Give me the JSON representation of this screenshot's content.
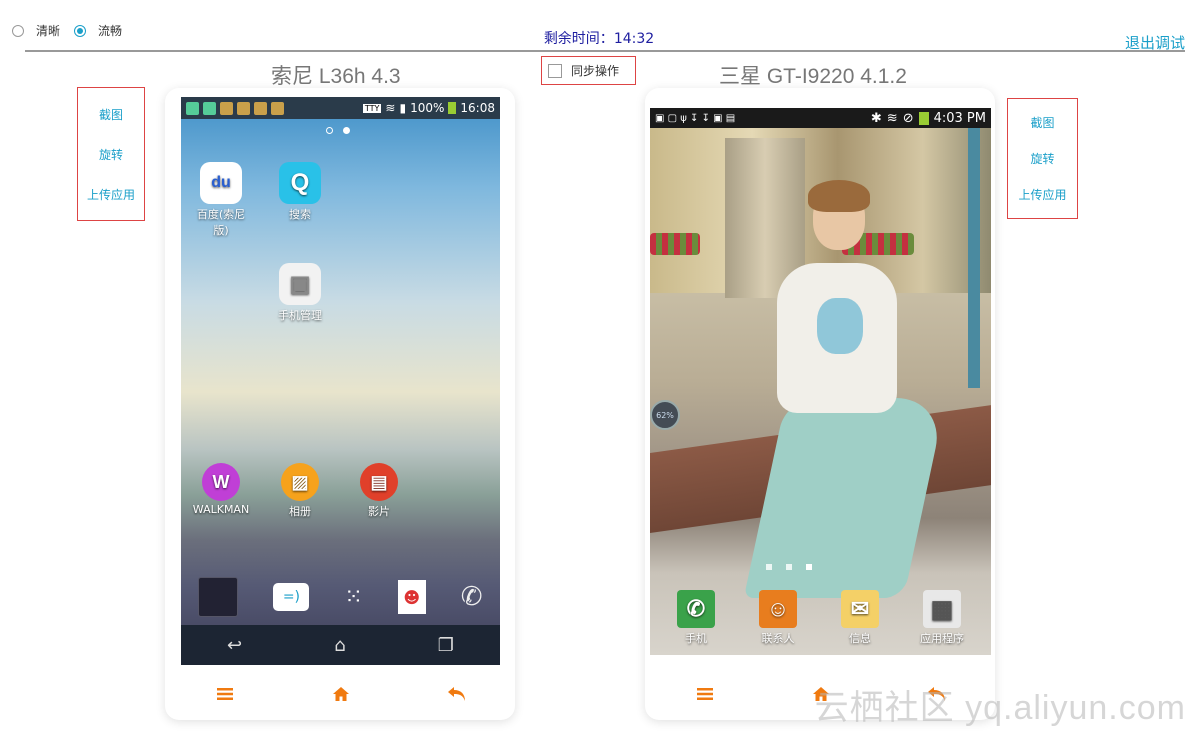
{
  "header": {
    "quality_options": [
      {
        "label": "清晰",
        "selected": false
      },
      {
        "label": "流畅",
        "selected": true
      }
    ],
    "timer_label": "剩余时间：",
    "timer_value": "14:32",
    "exit_label": "退出调试",
    "sync_label": "同步操作",
    "sync_checked": false
  },
  "devices": [
    {
      "title": "索尼 L36h 4.3",
      "actions": [
        "截图",
        "旋转",
        "上传应用"
      ],
      "status": {
        "battery": "100%",
        "time": "16:08",
        "carrier_badge": "TTY"
      },
      "apps": [
        {
          "label": "百度(索尼版)",
          "icon": "baidu-icon",
          "glyph": "du"
        },
        {
          "label": "搜索",
          "icon": "search-icon",
          "glyph": "Q"
        },
        {
          "label": "手机管理",
          "icon": "manager-icon",
          "glyph": "▣"
        },
        {
          "label": "WALKMAN",
          "icon": "walkman-icon",
          "glyph": "W"
        },
        {
          "label": "相册",
          "icon": "album-icon",
          "glyph": "▨"
        },
        {
          "label": "影片",
          "icon": "movie-icon",
          "glyph": "▤"
        }
      ],
      "dock": [
        "widget-icon",
        "messaging-icon",
        "apps-grid-icon",
        "contacts-icon",
        "phone-icon"
      ],
      "nav": [
        "back-icon",
        "home-icon",
        "recent-icon"
      ]
    },
    {
      "title": "三星 GT-I9220 4.1.2",
      "actions": [
        "截图",
        "旋转",
        "上传应用"
      ],
      "status": {
        "time": "4:03 PM"
      },
      "floating_badge": "62%",
      "apps": [
        {
          "label": "手机",
          "icon": "phone-icon",
          "glyph": "✆"
        },
        {
          "label": "联系人",
          "icon": "contacts-icon",
          "glyph": "☺"
        },
        {
          "label": "信息",
          "icon": "message-icon",
          "glyph": "✉"
        },
        {
          "label": "应用程序",
          "icon": "apps-grid-icon",
          "glyph": "▦"
        }
      ]
    }
  ],
  "toolbar_icons": [
    "menu-icon",
    "home-icon",
    "back-icon"
  ],
  "colors": {
    "accent": "#1a9fc9",
    "orange": "#f07a10",
    "highlight_border": "#dd4444",
    "timer": "#1e1ea0"
  },
  "watermark": "云栖社区 yq.aliyun.com"
}
